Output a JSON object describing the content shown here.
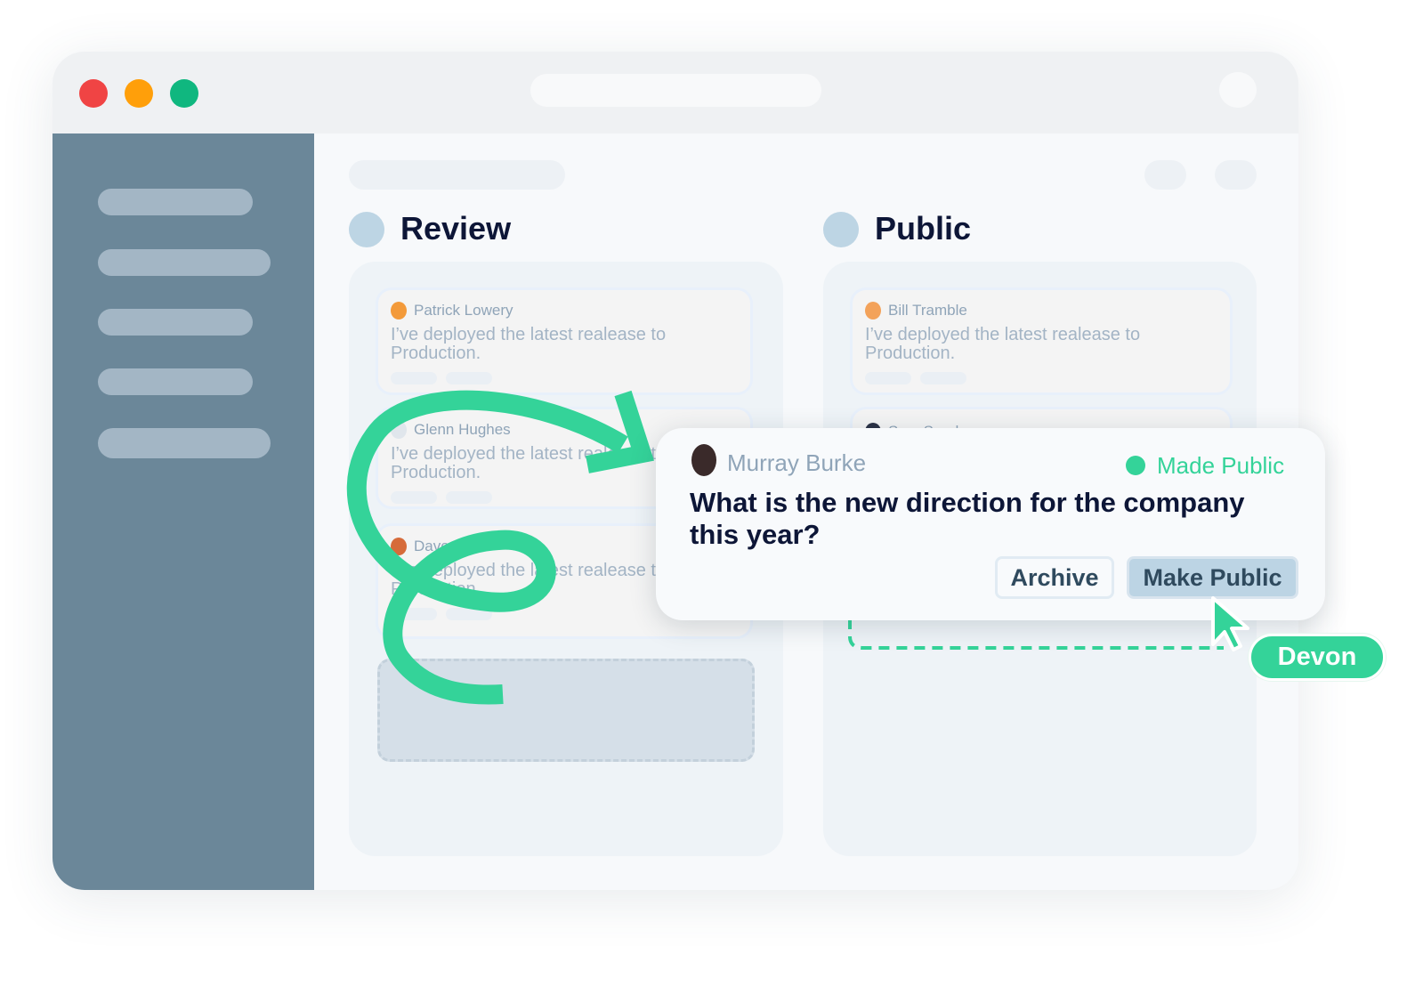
{
  "window": {
    "controls": [
      {
        "name": "close",
        "color": "#f04444"
      },
      {
        "name": "minimize",
        "color": "#ff9f0a"
      },
      {
        "name": "maximize",
        "color": "#10b77f"
      }
    ]
  },
  "columns": [
    {
      "title": "Review",
      "cards": [
        {
          "author": "Patrick Lowery",
          "message": "I’ve deployed the latest realease to Production."
        },
        {
          "author": "Glenn Hughes",
          "message": "I’ve deployed the latest realease to Production."
        },
        {
          "author": "Dave Tri",
          "message": "I’ve deployed the latest realease to Production."
        }
      ]
    },
    {
      "title": "Public",
      "cards": [
        {
          "author": "Bill Tramble",
          "message": "I’ve deployed the latest realease to Production."
        },
        {
          "author": "Sam Spade",
          "message": ""
        }
      ]
    }
  ],
  "popup": {
    "author": "Murray Burke",
    "status": "Made Public",
    "status_color": "#34d399",
    "question": "What is the new direction for the company this year?",
    "archive_label": "Archive",
    "make_public_label": "Make Public"
  },
  "cursor": {
    "user": "Devon",
    "color": "#34d399"
  }
}
